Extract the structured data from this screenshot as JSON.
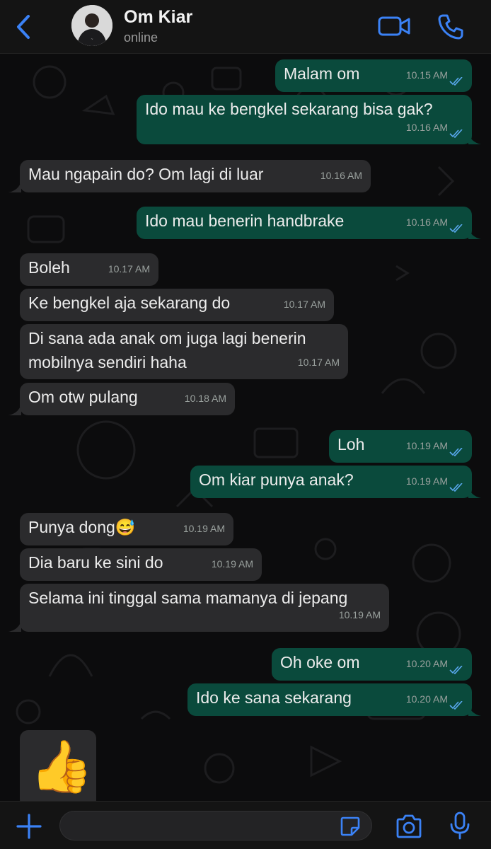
{
  "header": {
    "contact_name": "Om Kiar",
    "status": "online",
    "icons": [
      "chevron-left-icon",
      "video-camera-icon",
      "phone-icon"
    ],
    "accent_color": "#3b82f6"
  },
  "messages": [
    {
      "dir": "out",
      "text": "Malam om",
      "time": "10.15 AM",
      "read": true
    },
    {
      "dir": "out",
      "text": "Ido mau ke bengkel sekarang bisa gak?",
      "time": "10.16 AM",
      "read": true
    },
    {
      "dir": "in",
      "text": "Mau ngapain do? Om lagi di luar",
      "time": "10.16 AM"
    },
    {
      "dir": "out",
      "text": "Ido mau benerin handbrake",
      "time": "10.16 AM",
      "read": true
    },
    {
      "dir": "in",
      "text": "Boleh",
      "time": "10.17 AM"
    },
    {
      "dir": "in",
      "text": "Ke bengkel aja sekarang do",
      "time": "10.17 AM"
    },
    {
      "dir": "in",
      "text": "Di sana ada anak om juga lagi benerin",
      "text2": "mobilnya sendiri haha",
      "time": "10.17 AM"
    },
    {
      "dir": "in",
      "text": "Om otw pulang",
      "time": "10.18 AM"
    },
    {
      "dir": "out",
      "text": "Loh",
      "time": "10.19 AM",
      "read": true
    },
    {
      "dir": "out",
      "text": "Om kiar punya anak?",
      "time": "10.19 AM",
      "read": true
    },
    {
      "dir": "in",
      "text": "Punya dong😅",
      "time": "10.19 AM"
    },
    {
      "dir": "in",
      "text": "Dia baru ke sini do",
      "time": "10.19 AM"
    },
    {
      "dir": "in",
      "text": "Selama ini tinggal sama mamanya di jepang",
      "time": "10.19 AM"
    },
    {
      "dir": "out",
      "text": "Oh oke om",
      "time": "10.20 AM",
      "read": true
    },
    {
      "dir": "out",
      "text": "Ido ke sana sekarang",
      "time": "10.20 AM",
      "read": true
    }
  ],
  "sticker": {
    "emoji": "👍"
  },
  "composer": {
    "placeholder": "",
    "icons": [
      "plus-icon",
      "sticker-icon",
      "camera-icon",
      "microphone-icon"
    ]
  },
  "colors": {
    "outgoing_bubble": "#0a4a3c",
    "incoming_bubble": "#2b2b2d",
    "read_ticks": "#5aa9f0"
  }
}
